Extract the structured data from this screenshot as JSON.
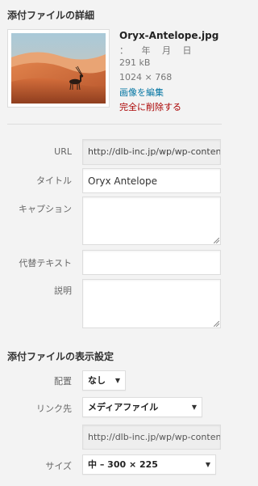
{
  "details": {
    "title": "添付ファイルの詳細",
    "filename": "Oryx-Antelope.jpg",
    "date": "：　　年　 月　 日",
    "filesize": "291 kB",
    "dimensions": "1024 × 768",
    "edit_link": "画像を編集",
    "delete_link": "完全に削除する"
  },
  "fields": {
    "url_label": "URL",
    "url_value": "http://dlb-inc.jp/wp/wp-content/uploads/Oryx-Antelope.jpg",
    "title_label": "タイトル",
    "title_value": "Oryx Antelope",
    "caption_label": "キャプション",
    "caption_value": "",
    "alt_label": "代替テキスト",
    "alt_value": "",
    "description_label": "説明",
    "description_value": ""
  },
  "display": {
    "title": "添付ファイルの表示設定",
    "align_label": "配置",
    "align_value": "なし",
    "link_label": "リンク先",
    "link_value": "メディアファイル",
    "link_url": "http://dlb-inc.jp/wp/wp-content/uploads/Oryx-Antelope.jpg",
    "size_label": "サイズ",
    "size_value": "中 – 300 × 225"
  },
  "colors": {
    "link": "#0074a2",
    "delete": "#aa0000",
    "background": "#f3f3f3"
  }
}
